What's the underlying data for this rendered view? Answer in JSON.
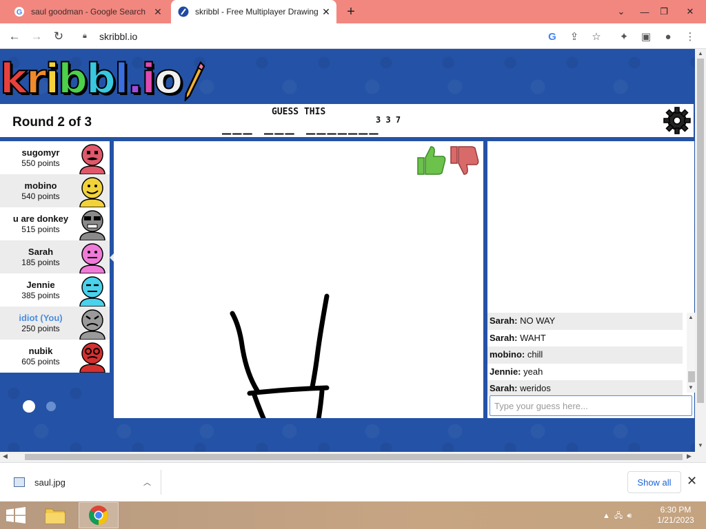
{
  "browser": {
    "tabs": [
      {
        "title": "saul goodman - Google Search",
        "icon": "google-icon"
      },
      {
        "title": "skribbl - Free Multiplayer Drawing",
        "icon": "skribbl-icon"
      }
    ],
    "url": "skribbl.io"
  },
  "game": {
    "logo": "kribbl.io",
    "round_text": "Round 2 of 3",
    "guess_label": "GUESS THIS",
    "word_blanks": "___ ___ _______",
    "word_lengths": "3 3 7"
  },
  "players": [
    {
      "name": "sugomyr",
      "points": "550 points",
      "avatar_color": "#e0586a"
    },
    {
      "name": "mobino",
      "points": "540 points",
      "avatar_color": "#f2d23a"
    },
    {
      "name": "u are donkey",
      "points": "515 points",
      "avatar_color": "#8a8a8a"
    },
    {
      "name": "Sarah",
      "points": "185 points",
      "avatar_color": "#f07ad8"
    },
    {
      "name": "Jennie",
      "points": "385 points",
      "avatar_color": "#4ad2ec"
    },
    {
      "name": "idiot (You)",
      "points": "250 points",
      "avatar_color": "#9a9a9a"
    },
    {
      "name": "nubik",
      "points": "605 points",
      "avatar_color": "#d43030"
    }
  ],
  "speech_bubble": "weridos",
  "chat": {
    "messages": [
      {
        "author": "Sarah:",
        "text": " NO WAY"
      },
      {
        "author": "Sarah:",
        "text": " WAHT"
      },
      {
        "author": "mobino:",
        "text": " chill"
      },
      {
        "author": "Jennie:",
        "text": " yeah"
      },
      {
        "author": "Sarah:",
        "text": " weridos"
      }
    ],
    "placeholder": "Type your guess here..."
  },
  "downloads": {
    "file": "saul.jpg",
    "show_all": "Show all"
  },
  "taskbar": {
    "time": "6:30 PM",
    "date": "1/21/2023"
  },
  "colors": {
    "tabstrip": "#f2877f",
    "page_background": "#2452a6",
    "thumbs_up": "#6cc24a",
    "thumbs_down": "#d96a6a"
  }
}
